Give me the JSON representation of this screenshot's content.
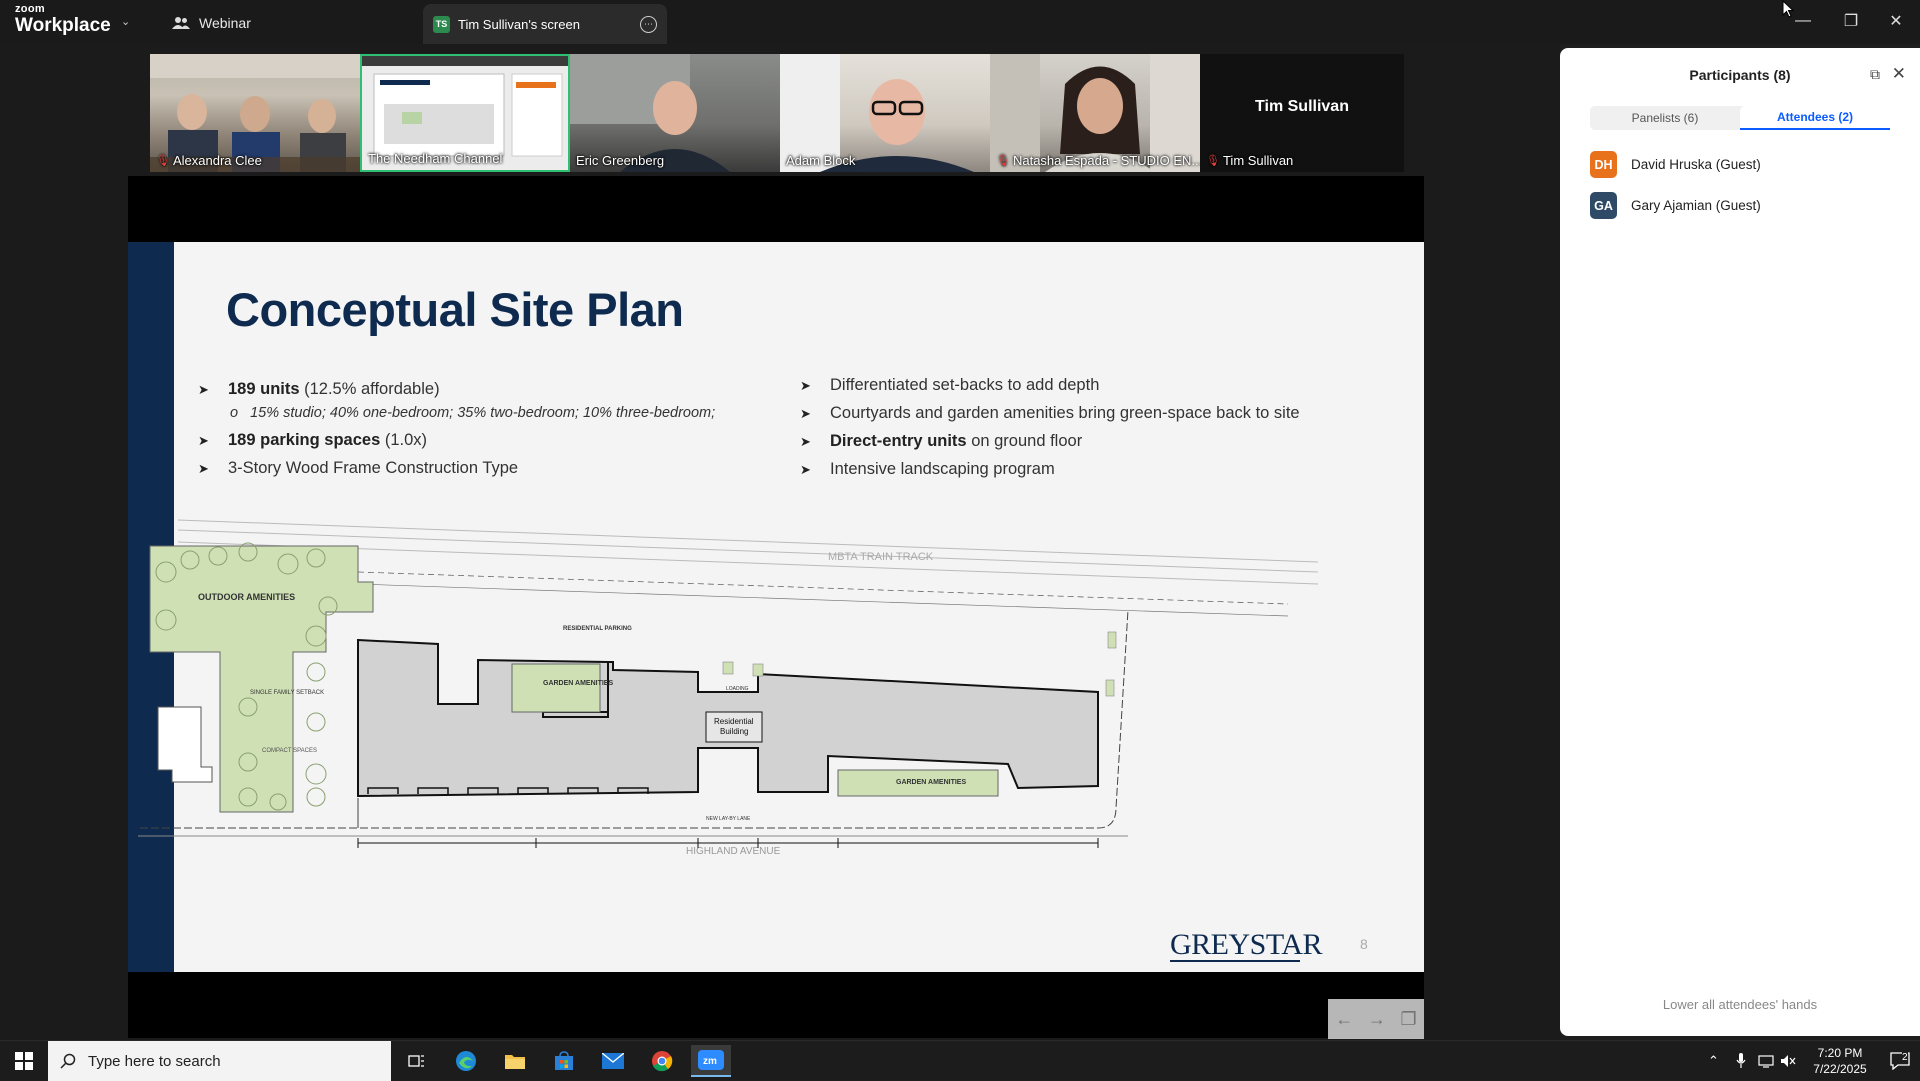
{
  "app": {
    "logo_top": "zoom",
    "logo_bottom": "Workplace",
    "tabs": [
      {
        "label": "Webinar"
      },
      {
        "label": "Tim Sullivan's screen",
        "badge": "TS"
      }
    ]
  },
  "video_strip": {
    "tiles": [
      {
        "name": "Alexandra Clee",
        "muted": true
      },
      {
        "name": "The Needham Channel",
        "muted": false,
        "active": true
      },
      {
        "name": "Eric Greenberg",
        "muted": false
      },
      {
        "name": "Adam Block",
        "muted": false
      },
      {
        "name": "Natasha Espada - STUDIO EN...",
        "muted": true
      },
      {
        "name": "Tim Sullivan",
        "muted": true,
        "display_name": "Tim Sullivan"
      }
    ]
  },
  "slide": {
    "title": "Conceptual Site Plan",
    "left_bullets": {
      "b1_bold": "189 units",
      "b1_rest": " (12.5% affordable)",
      "b1_sub": "15% studio; 40% one-bedroom; 35% two-bedroom; 10% three-bedroom;",
      "b2_bold": "189 parking spaces",
      "b2_rest": " (1.0x)",
      "b3": "3-Story Wood Frame Construction Type"
    },
    "right_bullets": {
      "b1": "Differentiated set-backs to add depth",
      "b2": "Courtyards and garden amenities bring green-space back to site",
      "b3_bold": "Direct-entry units",
      "b3_rest": " on ground floor",
      "b4": "Intensive landscaping program"
    },
    "plan_labels": {
      "train": "MBTA TRAIN TRACK",
      "avenue": "HIGHLAND AVENUE",
      "outdoor": "OUTDOOR AMENITIES",
      "garden1": "GARDEN AMENITIES",
      "garden2": "GARDEN AMENITIES",
      "residential_l1": "Residential",
      "residential_l2": "Building",
      "parking": "RESIDENTIAL PARKING",
      "loading": "LOADING",
      "setback": "SINGLE FAMILY SETBACK",
      "compact": "COMPACT SPACES",
      "lane": "NEW LAY-BY LANE"
    },
    "brand": "GREYSTAR",
    "page_number": "8"
  },
  "participants": {
    "title": "Participants (8)",
    "tabs": [
      {
        "label": "Panelists (6)",
        "active": false
      },
      {
        "label": "Attendees (2)",
        "active": true
      }
    ],
    "list": [
      {
        "initials": "DH",
        "name": "David Hruska (Guest)",
        "color": "#e8711c"
      },
      {
        "initials": "GA",
        "name": "Gary Ajamian (Guest)",
        "color": "#2f4a66"
      }
    ],
    "lower_hands": "Lower all attendees' hands"
  },
  "taskbar": {
    "search_placeholder": "Type here to search",
    "time": "7:20 PM",
    "date": "7/22/2025",
    "notification_count": "2"
  }
}
